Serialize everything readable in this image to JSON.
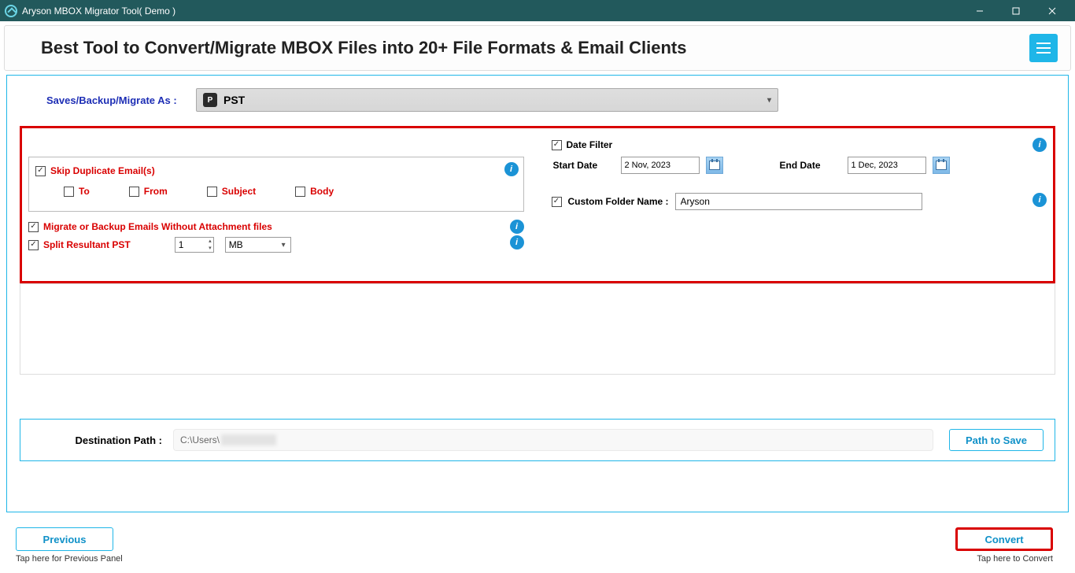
{
  "titlebar": {
    "title": "Aryson MBOX Migrator Tool( Demo )"
  },
  "header": {
    "headline": "Best Tool to Convert/Migrate MBOX Files into 20+ File Formats & Email Clients"
  },
  "saveas": {
    "label": "Saves/Backup/Migrate As :",
    "value": "PST",
    "badge": "P"
  },
  "skip_dup": {
    "label": "Skip Duplicate Email(s)",
    "sub": {
      "to": "To",
      "from": "From",
      "subject": "Subject",
      "body": "Body"
    }
  },
  "without_attach": {
    "label": "Migrate or Backup Emails Without Attachment files"
  },
  "split_pst": {
    "label": "Split Resultant PST",
    "size": "1",
    "unit": "MB"
  },
  "date_filter": {
    "label": "Date Filter",
    "start_label": "Start Date",
    "start_value": "2 Nov, 2023",
    "end_label": "End Date",
    "end_value": "1 Dec, 2023"
  },
  "custom_folder": {
    "label": "Custom Folder Name :",
    "value": "Aryson"
  },
  "dest": {
    "label": "Destination Path :",
    "value_prefix": "C:\\Users\\",
    "button": "Path to Save"
  },
  "footer": {
    "prev": "Previous",
    "prev_hint": "Tap here for Previous Panel",
    "convert": "Convert",
    "convert_hint": "Tap here to Convert"
  },
  "info_glyph": "i"
}
